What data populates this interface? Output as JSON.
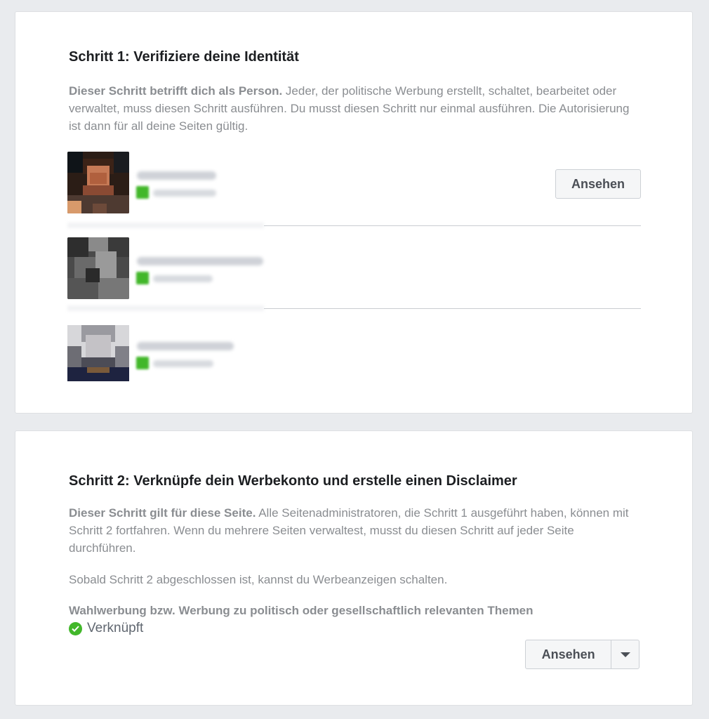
{
  "step1": {
    "title": "Schritt 1: Verifiziere deine Identität",
    "desc_bold": "Dieser Schritt betrifft dich als Person.",
    "desc_rest": " Jeder, der politische Werbung erstellt, schaltet, bearbeitet oder verwaltet, muss diesen Schritt ausführen. Du musst diesen Schritt nur einmal ausführen. Die Autorisierung ist dann für all deine Seiten gültig.",
    "view_button": "Ansehen",
    "people_count_note": "3 blurred people rows"
  },
  "step2": {
    "title": "Schritt 2: Verknüpfe dein Werbekonto und erstelle einen Disclaimer",
    "desc_bold": "Dieser Schritt gilt für diese Seite.",
    "desc_rest": " Alle Seitenadministratoren, die Schritt 1 ausgeführt haben, können mit Schritt 2 fortfahren. Wenn du mehrere Seiten verwaltest, musst du diesen Schritt auf jeder Seite durchführen.",
    "note": "Sobald Schritt 2 abgeschlossen ist, kannst du Werbeanzeigen schalten.",
    "category": "Wahlwerbung bzw. Werbung zu politisch oder gesellschaftlich relevanten Themen",
    "status": "Verknüpft",
    "view_button": "Ansehen",
    "status_icon": "check-circle-icon",
    "dropdown_icon": "caret-down-icon"
  },
  "colors": {
    "background": "#e9ebee",
    "card": "#ffffff",
    "muted_text": "#8a8d91",
    "success": "#42b72a"
  }
}
